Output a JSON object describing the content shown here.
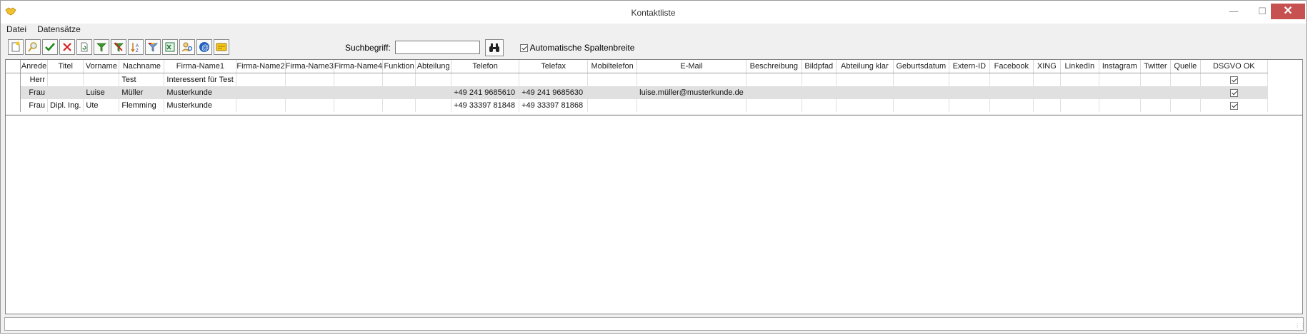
{
  "window": {
    "title": "Kontaktliste"
  },
  "menu": {
    "items": [
      "Datei",
      "Datensätze"
    ]
  },
  "toolbar": {
    "buttons": [
      {
        "icon": "new-record-icon"
      },
      {
        "icon": "search-magnifier-icon"
      },
      {
        "icon": "accept-check-icon"
      },
      {
        "icon": "delete-x-icon"
      },
      {
        "icon": "refresh-document-icon"
      },
      {
        "icon": "filter-icon"
      },
      {
        "icon": "remove-filter-icon"
      },
      {
        "icon": "sort-az-icon"
      },
      {
        "icon": "color-filter-icon"
      },
      {
        "icon": "excel-export-icon"
      },
      {
        "icon": "find-people-icon"
      },
      {
        "icon": "at-email-icon"
      },
      {
        "icon": "card-icon"
      }
    ],
    "colors": {
      "check": "#1a8a1a",
      "x": "#d21e1e",
      "filter": "#3a9a2a",
      "excel": "#1e7a3a",
      "email": "#2060c0"
    }
  },
  "search": {
    "label": "Suchbegriff:",
    "value": ""
  },
  "auto_width": {
    "label": "Automatische Spaltenbreite",
    "checked": true
  },
  "grid": {
    "columns": [
      "Anrede",
      "Titel",
      "Vorname",
      "Nachname",
      "Firma-Name1",
      "Firma-Name2",
      "Firma-Name3",
      "Firma-Name4",
      "Funktion",
      "Abteilung",
      "Telefon",
      "Telefax",
      "Mobiltelefon",
      "E-Mail",
      "Beschreibung",
      "Bildpfad",
      "Abteilung klar",
      "Geburtsdatum",
      "Extern-ID",
      "Facebook",
      "XING",
      "LinkedIn",
      "Instagram",
      "Twitter",
      "Quelle",
      "DSGVO OK"
    ],
    "rows": [
      {
        "selected": false,
        "cells": [
          "Herr",
          "",
          "",
          "Test",
          "Interessent für Test",
          "",
          "",
          "",
          "",
          "",
          "",
          "",
          "",
          "",
          "",
          "",
          "",
          "",
          "",
          "",
          "",
          "",
          "",
          "",
          "",
          ""
        ],
        "dsgvo": true
      },
      {
        "selected": true,
        "cells": [
          "Frau",
          "",
          "Luise",
          "Müller",
          "Musterkunde",
          "",
          "",
          "",
          "",
          "",
          "+49 241 9685610",
          "+49 241 9685630",
          "",
          "luise.müller@musterkunde.de",
          "",
          "",
          "",
          "",
          "",
          "",
          "",
          "",
          "",
          "",
          "",
          ""
        ],
        "dsgvo": true
      },
      {
        "selected": false,
        "cells": [
          "Frau",
          "Dipl. Ing.",
          "Ute",
          "Flemming",
          "Musterkunde",
          "",
          "",
          "",
          "",
          "",
          "+49 33397 81848",
          "+49 33397 81868",
          "",
          "",
          "",
          "",
          "",
          "",
          "",
          "",
          "",
          "",
          "",
          "",
          "",
          ""
        ],
        "dsgvo": true
      }
    ]
  },
  "status": {
    "text": ""
  }
}
